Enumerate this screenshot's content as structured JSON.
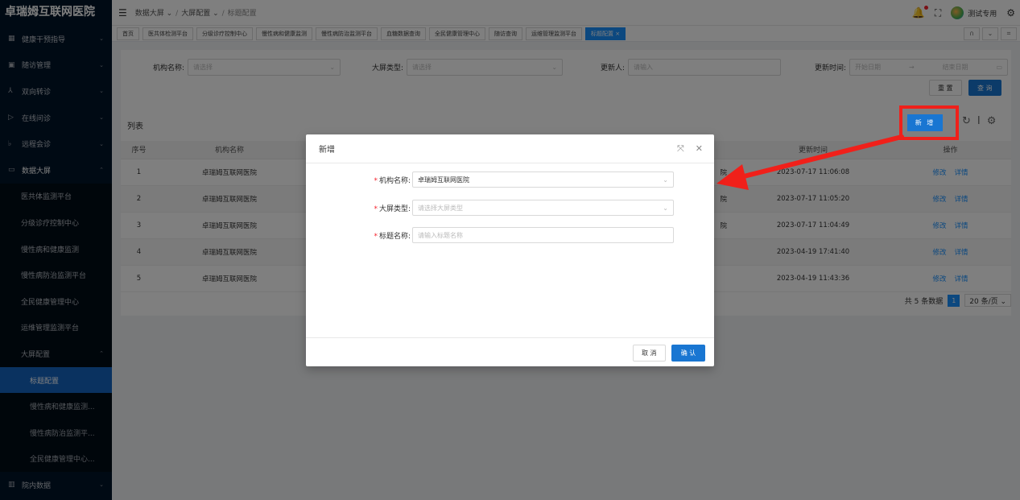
{
  "app": {
    "title": "卓瑞姆互联网医院"
  },
  "sidebar": {
    "items": [
      {
        "icon": "▦",
        "label": "健康干预指导",
        "arrow": "⌄"
      },
      {
        "icon": "▣",
        "label": "随访管理",
        "arrow": "⌄"
      },
      {
        "icon": "⅄",
        "label": "双向转诊",
        "arrow": "⌄"
      },
      {
        "icon": "▷",
        "label": "在线问诊",
        "arrow": "⌄"
      },
      {
        "icon": "♭",
        "label": "远程会诊",
        "arrow": "⌄"
      },
      {
        "icon": "▭",
        "label": "数据大屏",
        "arrow": "⌃"
      }
    ],
    "sub_items": [
      "医共体监测平台",
      "分级诊疗控制中心",
      "慢性病和健康监测",
      "慢性病防治监测平台",
      "全民健康管理中心",
      "运维管理监测平台"
    ],
    "config": {
      "label": "大屏配置",
      "arrow": "⌃"
    },
    "config_items": [
      "标题配置",
      "慢性病和健康监测...",
      "慢性病防治监测平...",
      "全民健康管理中心..."
    ],
    "last": {
      "icon": "▥",
      "label": "院内数据",
      "arrow": "⌄"
    }
  },
  "header": {
    "hamburger": "☰",
    "breadcrumb": [
      "数据大屏 ⌄",
      "大屏配置 ⌄",
      "标题配置"
    ],
    "sep": "/",
    "user": "测试专用",
    "bell": "♫",
    "fullscreen": "⛶",
    "settings": "⚙"
  },
  "tabs": [
    "首页",
    "医共体检测平台",
    "分级诊疗控制中心",
    "慢性病和健康监测",
    "慢性病防治监测平台",
    "血糖数据查询",
    "全民健康管理中心",
    "随访查询",
    "运维管理监测平台",
    "标题配置 ×"
  ],
  "tabs_right": [
    "∩",
    "⌄",
    "⌗"
  ],
  "search": {
    "org_label": "机构名称:",
    "org_placeholder": "请选择",
    "type_label": "大屏类型:",
    "type_placeholder": "请选择",
    "updater_label": "更新人:",
    "updater_placeholder": "请输入",
    "time_label": "更新时间:",
    "start_placeholder": "开始日期",
    "arrow": "→",
    "end_placeholder": "结束日期",
    "reset": "重 置",
    "query": "查 询"
  },
  "list": {
    "title": "列表",
    "add": "新 增",
    "columns": [
      "序号",
      "机构名称",
      "",
      "更新时间",
      "操作"
    ],
    "rows": [
      {
        "idx": "1",
        "org": "卓瑞姆互联网医院",
        "frag": "院",
        "time": "2023-07-17 11:06:08"
      },
      {
        "idx": "2",
        "org": "卓瑞姆互联网医院",
        "frag": "院",
        "time": "2023-07-17 11:05:20"
      },
      {
        "idx": "3",
        "org": "卓瑞姆互联网医院",
        "frag": "院",
        "time": "2023-07-17 11:04:49"
      },
      {
        "idx": "4",
        "org": "卓瑞姆互联网医院",
        "frag": "",
        "time": "2023-04-19 17:41:40"
      },
      {
        "idx": "5",
        "org": "卓瑞姆互联网医院",
        "frag": "",
        "time": "2023-04-19 11:43:36"
      }
    ],
    "edit": "修改",
    "detail": "详情",
    "total": "共 5 条数据",
    "page": "1",
    "page_size": "20 条/页 ⌄"
  },
  "modal": {
    "title": "新增",
    "org_label": "机构名称:",
    "org_value": "卓瑞姆互联网医院",
    "type_label": "大屏类型:",
    "type_placeholder": "请选择大屏类型",
    "title_label": "标题名称:",
    "title_placeholder": "请输入标题名称",
    "cancel": "取 消",
    "confirm": "确 认",
    "required": "*",
    "expand": "⤧",
    "close": "✕"
  },
  "colors": {
    "accent": "#1976d2",
    "highlight": "#f0201a",
    "sidebar_bg": "#001529"
  }
}
